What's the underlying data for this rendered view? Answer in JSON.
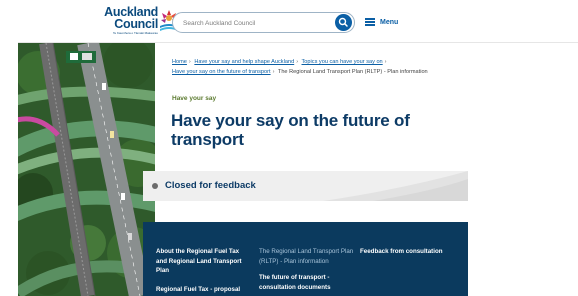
{
  "header": {
    "logo_line1": "Auckland",
    "logo_line2": "Council",
    "logo_tagline": "Te Kaunihera o Tāmaki Makaurau",
    "search_placeholder": "Search Auckland Council",
    "menu_label": "Menu"
  },
  "breadcrumb": {
    "items": [
      "Home",
      "Have your say and help shape Auckland",
      "Topics you can have your say on",
      "Have your say on the future of transport"
    ],
    "current": "The Regional Land Transport Plan (RLTP) - Plan information"
  },
  "page": {
    "kicker": "Have your say",
    "title": "Have your say on the future of transport",
    "status": "Closed for feedback"
  },
  "nav": {
    "col1": [
      "About the Regional Fuel Tax and Regional Land Transport Plan",
      "Regional Fuel Tax - proposal"
    ],
    "col2": [
      "The Regional Land Transport Plan (RLTP) - Plan information",
      "The future of transport - consultation documents"
    ],
    "col3": [
      "Feedback from consultation"
    ]
  },
  "colors": {
    "brand_blue": "#0b5fa5",
    "title_navy": "#0d3b66",
    "panel_navy": "#0b3a5e",
    "kicker_green": "#5b7a2f"
  }
}
